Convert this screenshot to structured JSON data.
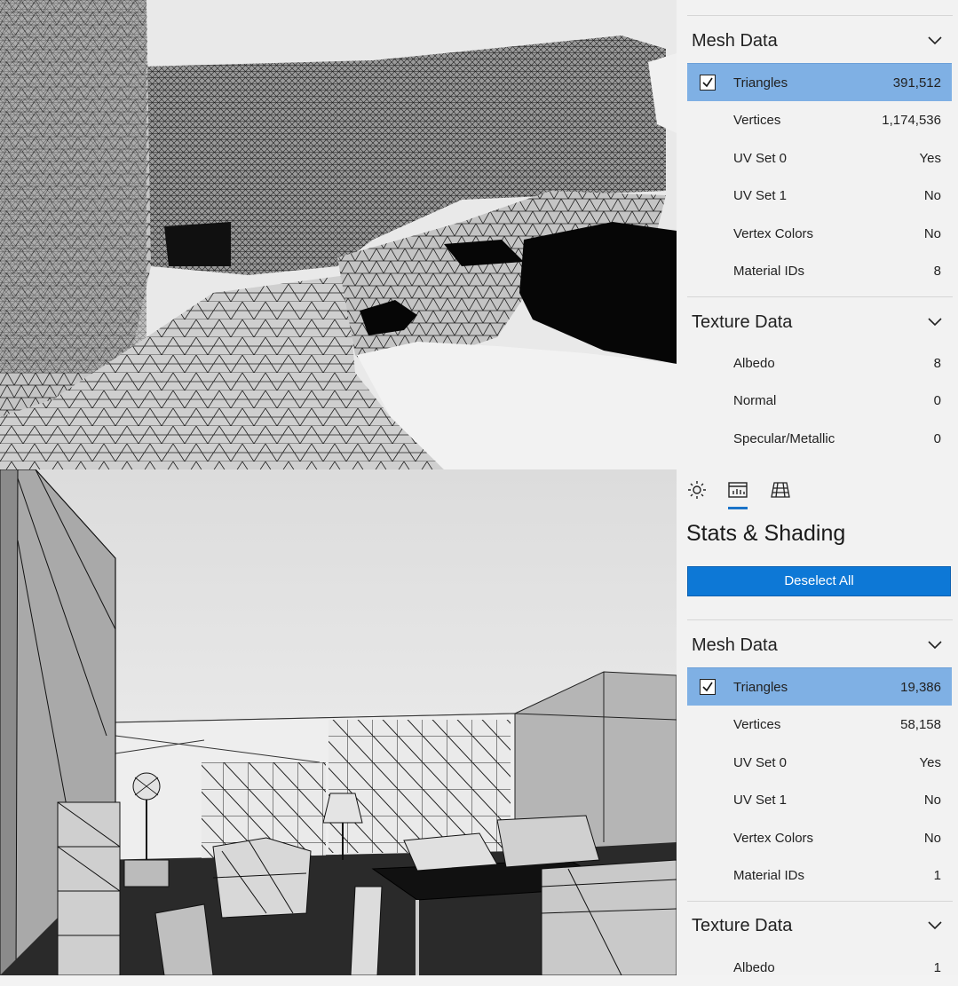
{
  "top_panel": {
    "mesh_section": {
      "title": "Mesh Data",
      "rows": [
        {
          "label": "Triangles",
          "value": "391,512",
          "selected": true
        },
        {
          "label": "Vertices",
          "value": "1,174,536"
        },
        {
          "label": "UV Set 0",
          "value": "Yes"
        },
        {
          "label": "UV Set 1",
          "value": "No"
        },
        {
          "label": "Vertex Colors",
          "value": "No"
        },
        {
          "label": "Material IDs",
          "value": "8"
        }
      ]
    },
    "texture_section": {
      "title": "Texture Data",
      "rows": [
        {
          "label": "Albedo",
          "value": "8"
        },
        {
          "label": "Normal",
          "value": "0"
        },
        {
          "label": "Specular/Metallic",
          "value": "0"
        }
      ]
    }
  },
  "bottom_panel": {
    "tabs": [
      "sun-icon",
      "stats-icon",
      "grid-icon"
    ],
    "active_tab": 1,
    "title": "Stats & Shading",
    "deselect_label": "Deselect All",
    "mesh_section": {
      "title": "Mesh Data",
      "rows": [
        {
          "label": "Triangles",
          "value": "19,386",
          "selected": true
        },
        {
          "label": "Vertices",
          "value": "58,158"
        },
        {
          "label": "UV Set 0",
          "value": "Yes"
        },
        {
          "label": "UV Set 1",
          "value": "No"
        },
        {
          "label": "Vertex Colors",
          "value": "No"
        },
        {
          "label": "Material IDs",
          "value": "1"
        }
      ]
    },
    "texture_section": {
      "title": "Texture Data",
      "rows": [
        {
          "label": "Albedo",
          "value": "1"
        }
      ]
    }
  },
  "colors": {
    "accent": "#0d78d6",
    "selected_row": "#7fb0e4"
  }
}
